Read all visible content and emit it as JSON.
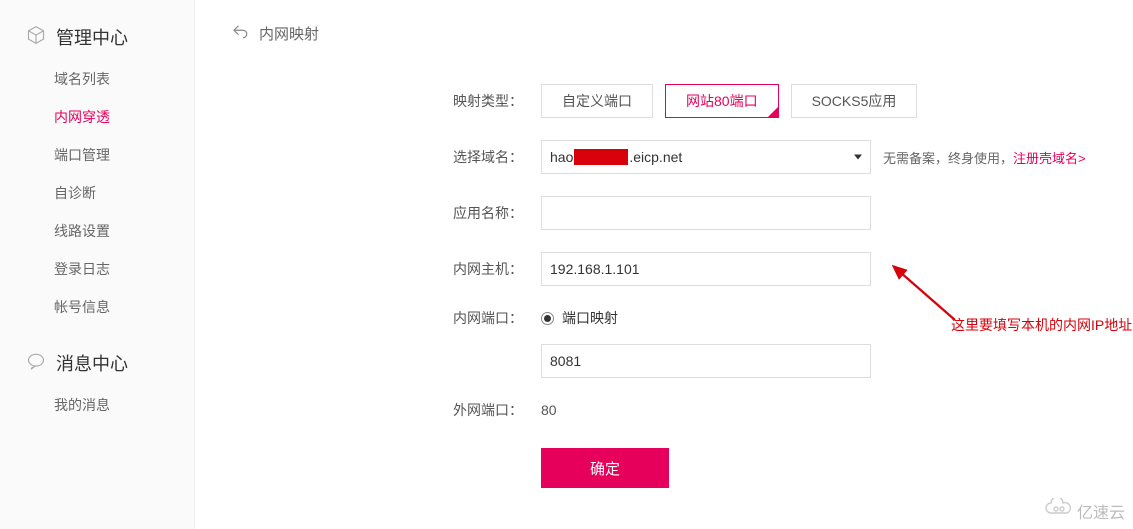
{
  "sidebar": {
    "section_mgmt": {
      "title": "管理中心",
      "items": [
        {
          "label": "域名列表"
        },
        {
          "label": "内网穿透",
          "active": true
        },
        {
          "label": "端口管理"
        },
        {
          "label": "自诊断"
        },
        {
          "label": "线路设置"
        },
        {
          "label": "登录日志"
        },
        {
          "label": "帐号信息"
        }
      ]
    },
    "section_msg": {
      "title": "消息中心",
      "items": [
        {
          "label": "我的消息"
        }
      ]
    }
  },
  "breadcrumb": {
    "title": "内网映射"
  },
  "form": {
    "labels": {
      "mapping_type": "映射类型：",
      "select_domain": "选择域名：",
      "app_name": "应用名称：",
      "lan_host": "内网主机：",
      "lan_port": "内网端口：",
      "wan_port": "外网端口："
    },
    "mapping_type_options": {
      "custom_port": "自定义端口",
      "web80": "网站80端口",
      "socks5": "SOCKS5应用"
    },
    "domain": {
      "prefix": "hao",
      "suffix": ".eicp.net",
      "help_text_1": "无需备案，终身使用，",
      "help_link": "注册壳域名>"
    },
    "app_name_value": "",
    "lan_host_value": "192.168.1.101",
    "lan_port": {
      "radio_label": "端口映射",
      "value": "8081"
    },
    "wan_port_value": "80",
    "submit_label": "确定"
  },
  "annotation": {
    "text": "这里要填写本机的内网IP地址"
  },
  "watermark": {
    "text": "亿速云"
  }
}
